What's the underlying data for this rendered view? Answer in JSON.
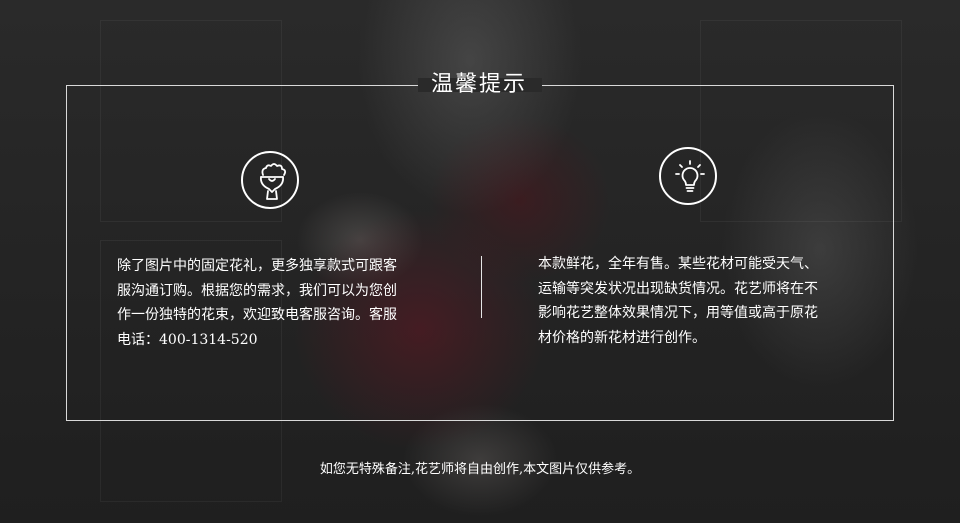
{
  "notice": {
    "title": "温馨提示",
    "left": {
      "icon": "bouquet-icon",
      "lines": [
        "除了图片中的固定花礼，更多独享款式可跟客",
        "服沟通订购。根据您的需求，我们可以为您创",
        "作一份独特的花束，欢迎致电客服咨询。客服",
        "电话：400-1314-520"
      ]
    },
    "right": {
      "icon": "lightbulb-icon",
      "lines": [
        "本款鲜花，全年有售。某些花材可能受天气、",
        "运输等突发状况出现缺货情况。花艺师将在不",
        "影响花艺整体效果情况下，用等值或高于原花",
        "材价格的新花材进行创作。"
      ]
    },
    "footnote": "如您无特殊备注,花艺师将自由创作,本文图片仅供参考。"
  },
  "colors": {
    "frame": "#d9d9d9",
    "text": "#ffffff",
    "background": "#262626"
  }
}
